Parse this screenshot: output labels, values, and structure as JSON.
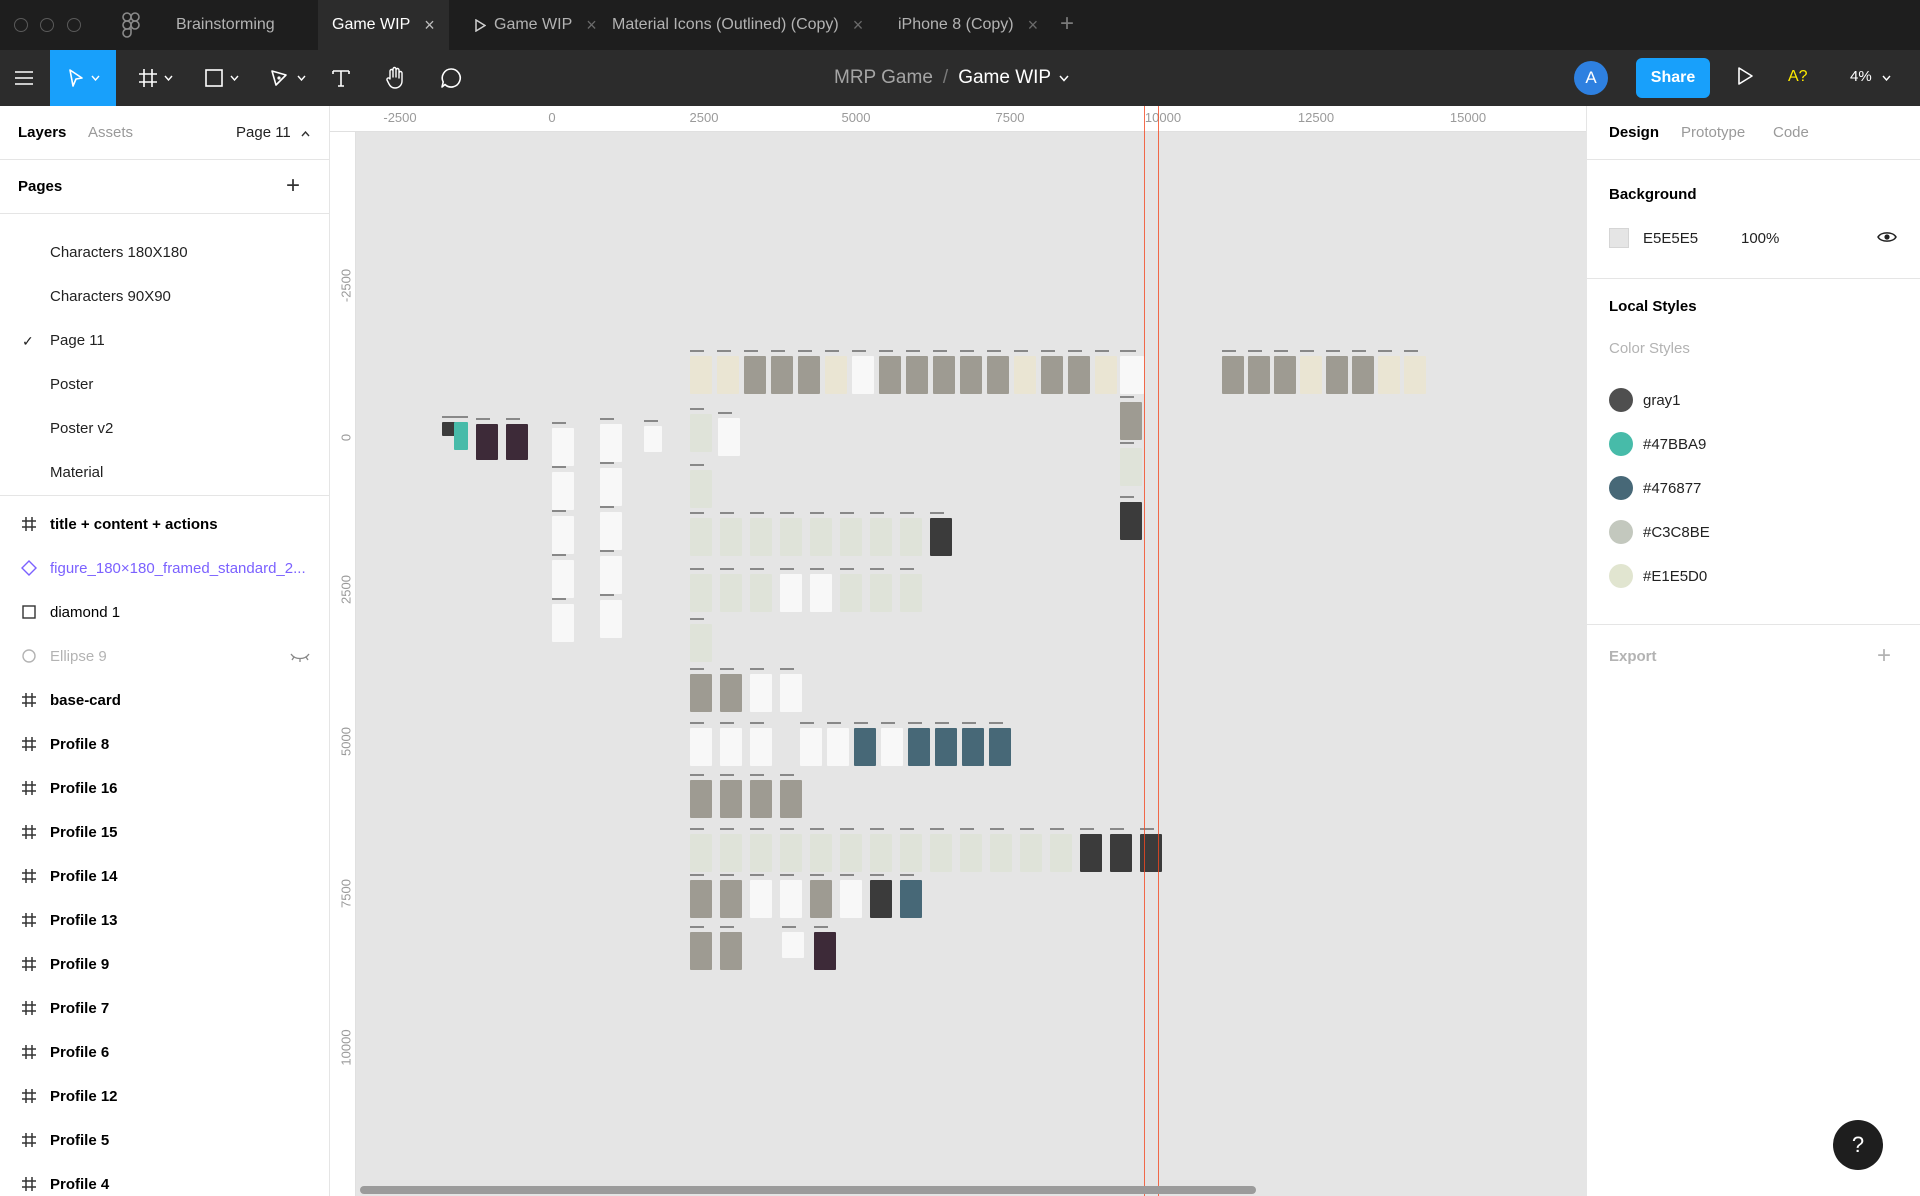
{
  "tabs": [
    {
      "label": "Brainstorming",
      "closable": false
    },
    {
      "label": "Game WIP",
      "closable": true,
      "active": true
    },
    {
      "label": "Game WIP",
      "closable": true,
      "prototype": true
    },
    {
      "label": "Material Icons (Outlined) (Copy)",
      "closable": true
    },
    {
      "label": "iPhone 8 (Copy)",
      "closable": true
    }
  ],
  "tab_add": "+",
  "toolbar": {
    "tools": [
      "menu-icon",
      "move-tool-icon",
      "frame-tool-icon",
      "shape-tool-icon",
      "pen-tool-icon",
      "text-tool-icon",
      "hand-tool-icon",
      "comment-tool-icon"
    ],
    "project": "MRP Game",
    "separator": "/",
    "file": "Game WIP",
    "avatar": "A",
    "share": "Share",
    "a11y": "A?",
    "zoom": "4%"
  },
  "left_panel": {
    "tabs": [
      "Layers",
      "Assets"
    ],
    "page_selector": "Page 11",
    "pages_title": "Pages",
    "pages": [
      {
        "name": "Characters 180X180"
      },
      {
        "name": "Characters 90X90"
      },
      {
        "name": "Page 11",
        "current": true
      },
      {
        "name": "Poster"
      },
      {
        "name": "Poster v2"
      },
      {
        "name": "Material"
      }
    ],
    "layers": [
      {
        "name": "title + content + actions",
        "kind": "frame"
      },
      {
        "name": "figure_180×180_framed_standard_2...",
        "kind": "component"
      },
      {
        "name": "diamond 1",
        "kind": "rect"
      },
      {
        "name": "Ellipse 9",
        "kind": "ellipse",
        "hidden": true
      },
      {
        "name": "base-card",
        "kind": "frame"
      },
      {
        "name": "Profile 8",
        "kind": "frame"
      },
      {
        "name": "Profile 16",
        "kind": "frame"
      },
      {
        "name": "Profile 15",
        "kind": "frame"
      },
      {
        "name": "Profile 14",
        "kind": "frame"
      },
      {
        "name": "Profile 13",
        "kind": "frame"
      },
      {
        "name": "Profile 9",
        "kind": "frame"
      },
      {
        "name": "Profile 7",
        "kind": "frame"
      },
      {
        "name": "Profile 6",
        "kind": "frame"
      },
      {
        "name": "Profile 12",
        "kind": "frame"
      },
      {
        "name": "Profile 5",
        "kind": "frame"
      },
      {
        "name": "Profile 4",
        "kind": "frame"
      }
    ]
  },
  "canvas": {
    "ruler_x": [
      "-2500",
      "0",
      "2500",
      "5000",
      "7500",
      "10000",
      "12500",
      "15000"
    ],
    "ruler_y": [
      "-2500",
      "0",
      "2500",
      "5000",
      "7500",
      "10000"
    ],
    "frame_colors": {
      "sand": "#eae5d3",
      "gray": "#9e9b92",
      "mint": "#dfe3d9",
      "teal": "#47bba9",
      "slate": "#476877",
      "dark": "#3b3b3b",
      "white": "#f8f8f8",
      "plum": "#3d2a38"
    }
  },
  "right_panel": {
    "tabs": [
      "Design",
      "Prototype",
      "Code"
    ],
    "background_title": "Background",
    "background_hex": "E5E5E5",
    "background_opacity": "100%",
    "local_styles_title": "Local Styles",
    "color_styles_title": "Color Styles",
    "color_styles": [
      {
        "name": "gray1",
        "color": "#4f4f4f"
      },
      {
        "name": "#47BBA9",
        "color": "#47bba9"
      },
      {
        "name": "#476877",
        "color": "#476877"
      },
      {
        "name": "#C3C8BE",
        "color": "#c3c8be"
      },
      {
        "name": "#E1E5D0",
        "color": "#e1e5d0"
      }
    ],
    "export_title": "Export",
    "export_add": "+"
  },
  "help": "?"
}
